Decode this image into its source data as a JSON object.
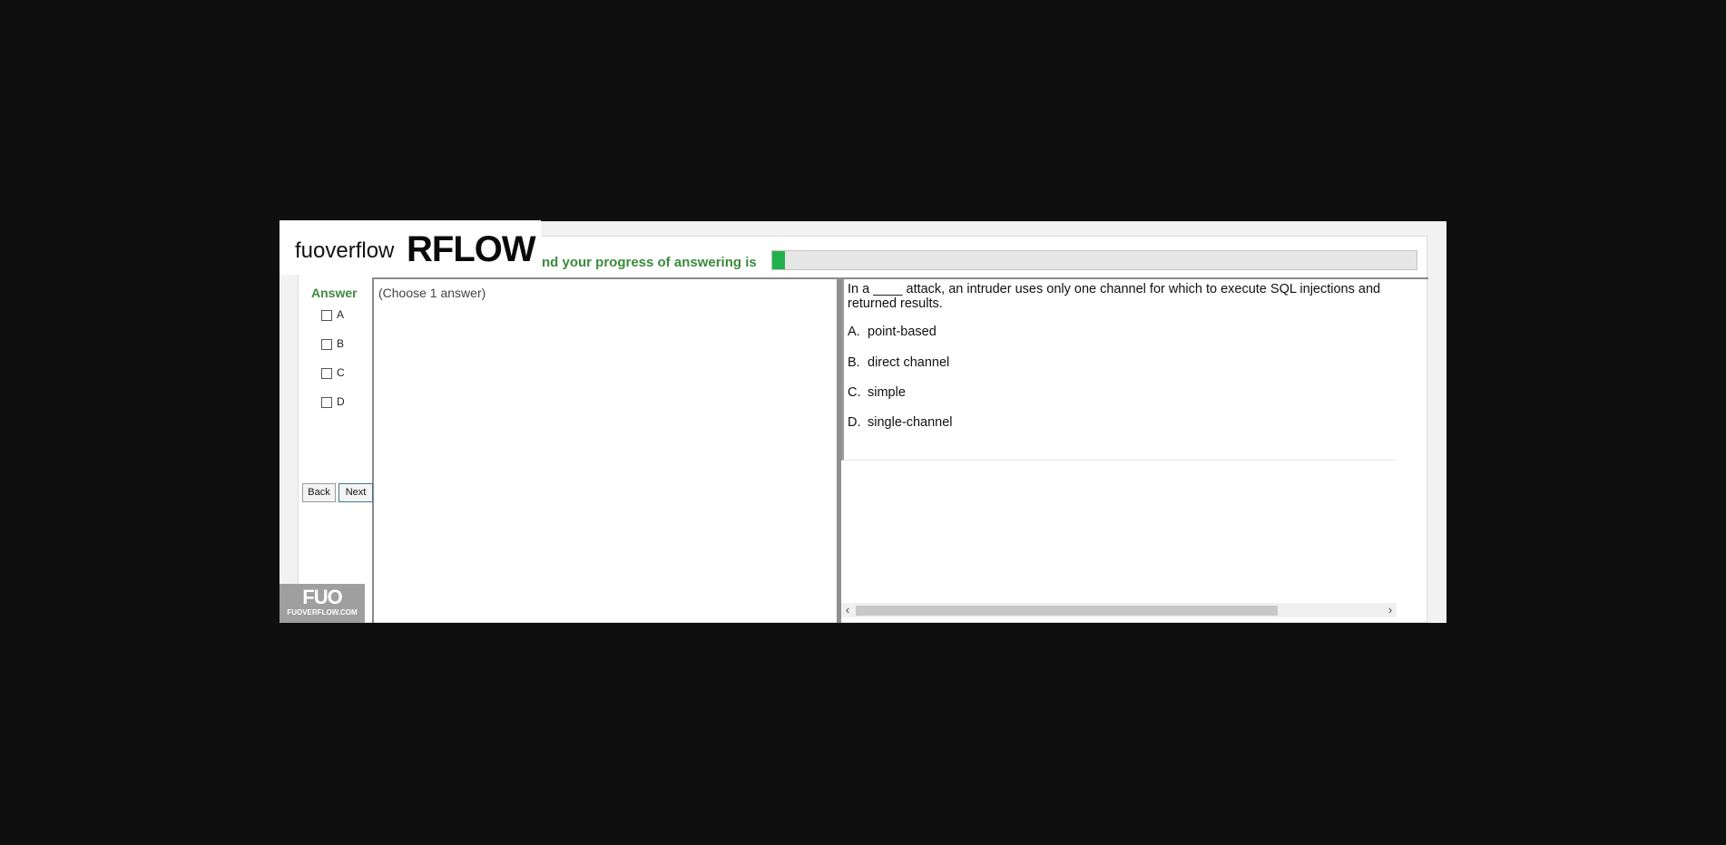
{
  "progress": {
    "label": "nd your progress of answering is",
    "value_percent": 2,
    "fill_color": "#22b14c"
  },
  "answer_panel": {
    "heading": "Answer",
    "options": [
      "A",
      "B",
      "C",
      "D"
    ],
    "back_label": "Back",
    "next_label": "Next"
  },
  "instructions": "(Choose 1 answer)",
  "question": {
    "text": "In a ____ attack, an intruder uses only one channel for which to execute SQL injections and returned results.",
    "options": [
      {
        "letter": "A.",
        "text": "point-based"
      },
      {
        "letter": "B.",
        "text": "direct channel"
      },
      {
        "letter": "C.",
        "text": "simple"
      },
      {
        "letter": "D.",
        "text": "single-channel"
      }
    ]
  },
  "scrollbar": {
    "left_arrow": "‹",
    "right_arrow": "›"
  },
  "overlay_logo": {
    "small": "fuoverflow",
    "big": "RFLOW"
  },
  "watermark": {
    "main": "FUO",
    "sub": "FUOVERFLOW.COM"
  }
}
